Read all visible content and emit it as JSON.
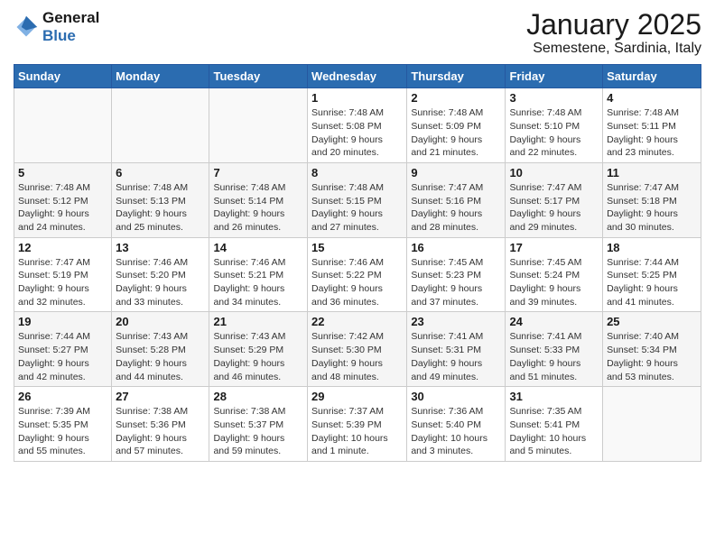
{
  "header": {
    "logo_line1": "General",
    "logo_line2": "Blue",
    "month": "January 2025",
    "location": "Semestene, Sardinia, Italy"
  },
  "weekdays": [
    "Sunday",
    "Monday",
    "Tuesday",
    "Wednesday",
    "Thursday",
    "Friday",
    "Saturday"
  ],
  "weeks": [
    [
      {
        "day": "",
        "info": ""
      },
      {
        "day": "",
        "info": ""
      },
      {
        "day": "",
        "info": ""
      },
      {
        "day": "1",
        "info": "Sunrise: 7:48 AM\nSunset: 5:08 PM\nDaylight: 9 hours\nand 20 minutes."
      },
      {
        "day": "2",
        "info": "Sunrise: 7:48 AM\nSunset: 5:09 PM\nDaylight: 9 hours\nand 21 minutes."
      },
      {
        "day": "3",
        "info": "Sunrise: 7:48 AM\nSunset: 5:10 PM\nDaylight: 9 hours\nand 22 minutes."
      },
      {
        "day": "4",
        "info": "Sunrise: 7:48 AM\nSunset: 5:11 PM\nDaylight: 9 hours\nand 23 minutes."
      }
    ],
    [
      {
        "day": "5",
        "info": "Sunrise: 7:48 AM\nSunset: 5:12 PM\nDaylight: 9 hours\nand 24 minutes."
      },
      {
        "day": "6",
        "info": "Sunrise: 7:48 AM\nSunset: 5:13 PM\nDaylight: 9 hours\nand 25 minutes."
      },
      {
        "day": "7",
        "info": "Sunrise: 7:48 AM\nSunset: 5:14 PM\nDaylight: 9 hours\nand 26 minutes."
      },
      {
        "day": "8",
        "info": "Sunrise: 7:48 AM\nSunset: 5:15 PM\nDaylight: 9 hours\nand 27 minutes."
      },
      {
        "day": "9",
        "info": "Sunrise: 7:47 AM\nSunset: 5:16 PM\nDaylight: 9 hours\nand 28 minutes."
      },
      {
        "day": "10",
        "info": "Sunrise: 7:47 AM\nSunset: 5:17 PM\nDaylight: 9 hours\nand 29 minutes."
      },
      {
        "day": "11",
        "info": "Sunrise: 7:47 AM\nSunset: 5:18 PM\nDaylight: 9 hours\nand 30 minutes."
      }
    ],
    [
      {
        "day": "12",
        "info": "Sunrise: 7:47 AM\nSunset: 5:19 PM\nDaylight: 9 hours\nand 32 minutes."
      },
      {
        "day": "13",
        "info": "Sunrise: 7:46 AM\nSunset: 5:20 PM\nDaylight: 9 hours\nand 33 minutes."
      },
      {
        "day": "14",
        "info": "Sunrise: 7:46 AM\nSunset: 5:21 PM\nDaylight: 9 hours\nand 34 minutes."
      },
      {
        "day": "15",
        "info": "Sunrise: 7:46 AM\nSunset: 5:22 PM\nDaylight: 9 hours\nand 36 minutes."
      },
      {
        "day": "16",
        "info": "Sunrise: 7:45 AM\nSunset: 5:23 PM\nDaylight: 9 hours\nand 37 minutes."
      },
      {
        "day": "17",
        "info": "Sunrise: 7:45 AM\nSunset: 5:24 PM\nDaylight: 9 hours\nand 39 minutes."
      },
      {
        "day": "18",
        "info": "Sunrise: 7:44 AM\nSunset: 5:25 PM\nDaylight: 9 hours\nand 41 minutes."
      }
    ],
    [
      {
        "day": "19",
        "info": "Sunrise: 7:44 AM\nSunset: 5:27 PM\nDaylight: 9 hours\nand 42 minutes."
      },
      {
        "day": "20",
        "info": "Sunrise: 7:43 AM\nSunset: 5:28 PM\nDaylight: 9 hours\nand 44 minutes."
      },
      {
        "day": "21",
        "info": "Sunrise: 7:43 AM\nSunset: 5:29 PM\nDaylight: 9 hours\nand 46 minutes."
      },
      {
        "day": "22",
        "info": "Sunrise: 7:42 AM\nSunset: 5:30 PM\nDaylight: 9 hours\nand 48 minutes."
      },
      {
        "day": "23",
        "info": "Sunrise: 7:41 AM\nSunset: 5:31 PM\nDaylight: 9 hours\nand 49 minutes."
      },
      {
        "day": "24",
        "info": "Sunrise: 7:41 AM\nSunset: 5:33 PM\nDaylight: 9 hours\nand 51 minutes."
      },
      {
        "day": "25",
        "info": "Sunrise: 7:40 AM\nSunset: 5:34 PM\nDaylight: 9 hours\nand 53 minutes."
      }
    ],
    [
      {
        "day": "26",
        "info": "Sunrise: 7:39 AM\nSunset: 5:35 PM\nDaylight: 9 hours\nand 55 minutes."
      },
      {
        "day": "27",
        "info": "Sunrise: 7:38 AM\nSunset: 5:36 PM\nDaylight: 9 hours\nand 57 minutes."
      },
      {
        "day": "28",
        "info": "Sunrise: 7:38 AM\nSunset: 5:37 PM\nDaylight: 9 hours\nand 59 minutes."
      },
      {
        "day": "29",
        "info": "Sunrise: 7:37 AM\nSunset: 5:39 PM\nDaylight: 10 hours\nand 1 minute."
      },
      {
        "day": "30",
        "info": "Sunrise: 7:36 AM\nSunset: 5:40 PM\nDaylight: 10 hours\nand 3 minutes."
      },
      {
        "day": "31",
        "info": "Sunrise: 7:35 AM\nSunset: 5:41 PM\nDaylight: 10 hours\nand 5 minutes."
      },
      {
        "day": "",
        "info": ""
      }
    ]
  ]
}
